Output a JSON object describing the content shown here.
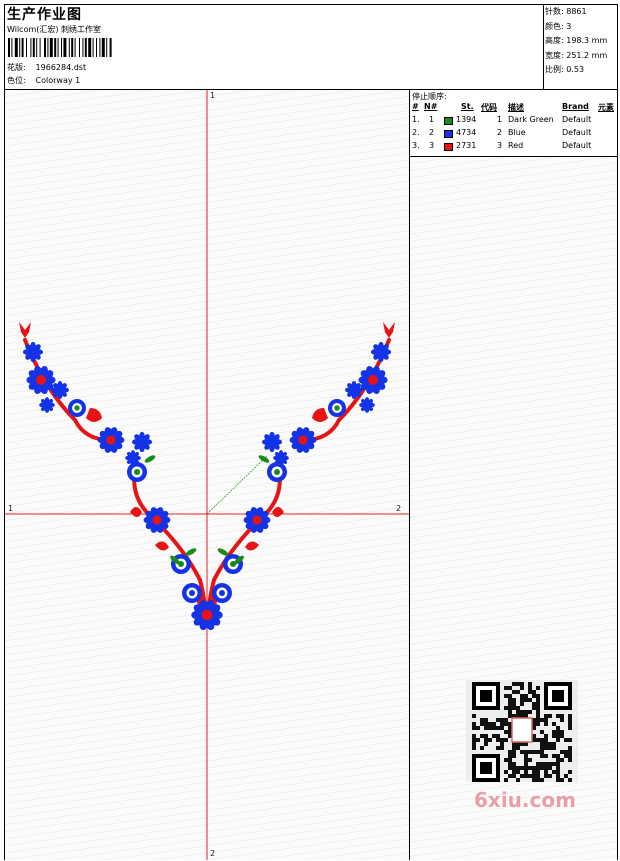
{
  "header": {
    "title": "生产作业图",
    "studio": "Wilcom(汇宏) 刺绣工作室",
    "design_label": "花版:",
    "design_value": "1966284.dst",
    "color_label": "色位:",
    "color_value": "Colorway 1"
  },
  "stats": {
    "stitches": "针数: 8861",
    "colors": "颜色: 3",
    "height": "高度: 198.3 mm",
    "width": "宽度: 251.2 mm",
    "scale": "比例: 0.53"
  },
  "axes": {
    "top": "1",
    "bottom": "2",
    "left": "1",
    "right": "2"
  },
  "stop_sequence": {
    "caption": "停止顺序:",
    "headers": [
      "#",
      "N#",
      "St.",
      "代码",
      "描述",
      "Brand",
      "元素"
    ],
    "rows": [
      {
        "num": "1.",
        "n": "1",
        "color": "#1a8a1a",
        "st": "1394",
        "code": "1",
        "desc": "Dark Green",
        "brand": "Default"
      },
      {
        "num": "2.",
        "n": "2",
        "color": "#1432e6",
        "st": "4734",
        "code": "2",
        "desc": "Blue",
        "brand": "Default"
      },
      {
        "num": "3.",
        "n": "3",
        "color": "#e61414",
        "st": "2731",
        "code": "3",
        "desc": "Red",
        "brand": "Default"
      }
    ]
  },
  "thread_colors": {
    "green": "#1a8a1a",
    "blue": "#1432e6",
    "red": "#e61414"
  },
  "watermark": {
    "site": "6xiu.com",
    "qr_icon": "qr-code-icon"
  }
}
